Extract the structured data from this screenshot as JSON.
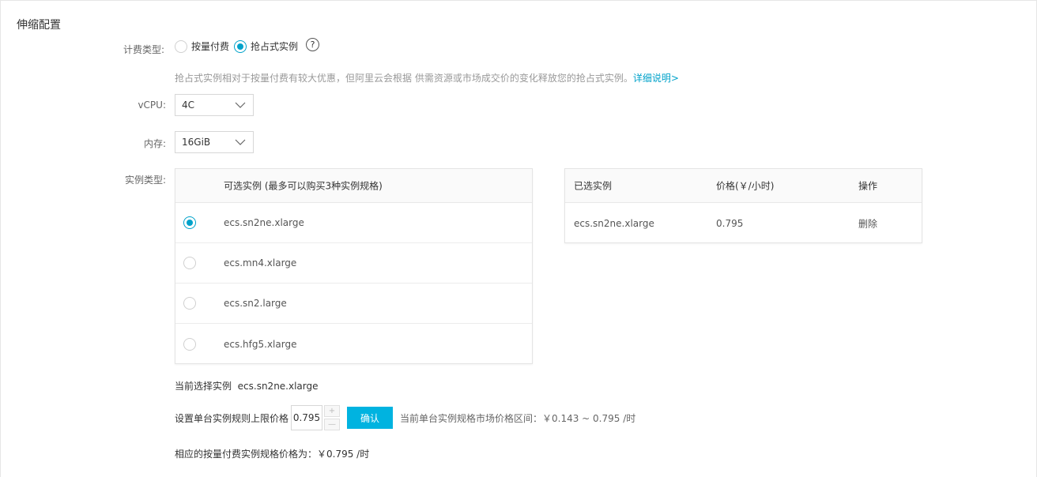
{
  "section_title": "伸缩配置",
  "billing": {
    "label": "计费类型:",
    "options": [
      {
        "label": "按量付费",
        "selected": false
      },
      {
        "label": "抢占式实例",
        "selected": true
      }
    ],
    "help_icon": "question-circle-icon",
    "help_glyph": "?"
  },
  "description": {
    "text": "抢占式实例相对于按量付费有较大优惠，但阿里云会根据 供需资源或市场成交价的变化释放您的抢占式实例。",
    "link": "详细说明>"
  },
  "vcpu": {
    "label": "vCPU:",
    "value": "4C"
  },
  "memory": {
    "label": "内存:",
    "value": "16GiB"
  },
  "instance_type": {
    "label": "实例类型:",
    "available": {
      "header": "可选实例 (最多可以购买3种实例规格)",
      "rows": [
        {
          "name": "ecs.sn2ne.xlarge",
          "selected": true
        },
        {
          "name": "ecs.mn4.xlarge",
          "selected": false
        },
        {
          "name": "ecs.sn2.large",
          "selected": false
        },
        {
          "name": "ecs.hfg5.xlarge",
          "selected": false
        }
      ]
    },
    "selected": {
      "headers": [
        "已选实例",
        "价格(￥/小时)",
        "操作"
      ],
      "rows": [
        {
          "name": "ecs.sn2ne.xlarge",
          "price": "0.795",
          "action": "删除"
        }
      ]
    }
  },
  "current_selection": {
    "label": "当前选择实例",
    "value": "ecs.sn2ne.xlarge"
  },
  "price_limit": {
    "label": "设置单台实例规则上限价格",
    "value": "0.795",
    "increment_glyph": "+",
    "decrement_glyph": "—",
    "confirm_label": "确认",
    "range_text": "当前单台实例规格市场价格区间：￥0.143 ~ 0.795 /时"
  },
  "pay_as_you_go_price": "相应的按量付费实例规格价格为：￥0.795 /时",
  "colors": {
    "accent": "#00a2ca",
    "button": "#00b3e0"
  }
}
